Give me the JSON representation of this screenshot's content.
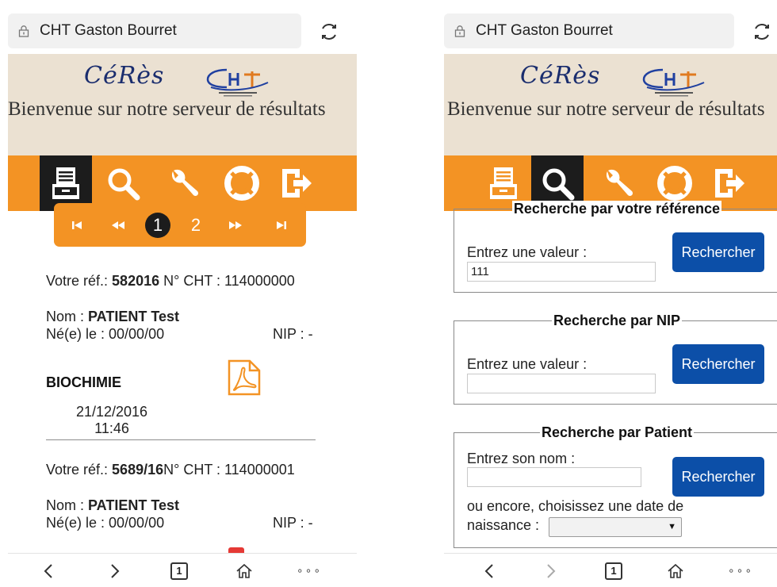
{
  "browser": {
    "site_title": "CHT Gaston Bourret",
    "tab_count": "1",
    "more": "∘∘∘"
  },
  "header": {
    "logo_text": "CéRès",
    "welcome": "Bienvenue sur notre serveur de résultats"
  },
  "nav": {
    "items": [
      "results-list",
      "search",
      "settings",
      "help",
      "logout"
    ],
    "phone_a_active": "results-list",
    "phone_b_active": "search"
  },
  "results": {
    "pager": {
      "active_page": "1",
      "other_page": "2"
    },
    "entries": [
      {
        "ref_label": "Votre réf.: ",
        "ref_value": "582016",
        "cht_text": " N° CHT : 114000000",
        "name_label": "Nom : ",
        "name_value": "PATIENT Test",
        "dob": "Né(e) le : 00/00/00",
        "nip": "NIP : -",
        "section": "BIOCHIMIE",
        "date": "21/12/2016",
        "time": "11:46"
      },
      {
        "ref_label": "Votre réf.: ",
        "ref_value": "5689/16",
        "cht_text": "N° CHT : 114000001",
        "name_label": "Nom : ",
        "name_value": "PATIENT Test",
        "dob": "Né(e) le : 00/00/00",
        "nip": "NIP : -"
      }
    ]
  },
  "search": {
    "by_reference": {
      "title": "Recherche par votre référence",
      "label": "Entrez une valeur :",
      "value": "111",
      "button": "Rechercher"
    },
    "by_nip": {
      "title": "Recherche par NIP",
      "label": "Entrez une valeur :",
      "value": "",
      "button": "Rechercher"
    },
    "by_patient": {
      "title": "Recherche par Patient",
      "name_label": "Entrez son nom :",
      "name_value": "",
      "button": "Rechercher",
      "dob_label_1": "ou encore, choisissez une date de",
      "dob_label_2": "naissance :",
      "dob_selected": ""
    }
  },
  "colors": {
    "accent_orange": "#f39324",
    "header_beige": "#ebe1d2",
    "button_blue": "#0c4fa8",
    "active_nav": "#1c1c1c"
  }
}
